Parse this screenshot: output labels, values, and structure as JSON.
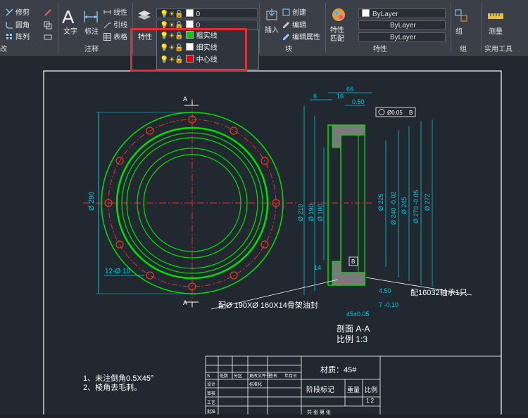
{
  "ribbon": {
    "modify": {
      "trim": "修剪",
      "fillet": "圆角",
      "array": "阵列",
      "panel_tail": "改"
    },
    "annotation": {
      "text": "文字",
      "dim": "标注",
      "linear": "线性",
      "leader": "引线",
      "table": "表格",
      "label": "注释"
    },
    "layers": {
      "props_btn": "特性",
      "current_layer": "0",
      "current_layer2": "0"
    },
    "insert": {
      "insert": "插入",
      "create": "创建",
      "edit": "编辑",
      "edit_attr": "编辑属性",
      "label": "块"
    },
    "properties": {
      "match": "特性\n匹配",
      "match1": "特性",
      "match2": "匹配",
      "color": "ByLayer",
      "linetype": "ByLayer",
      "lineweight": "ByLayer",
      "label": "特性"
    },
    "groups": {
      "group": "组",
      "label": "组"
    },
    "utilities": {
      "measure": "测量",
      "label": "实用工具"
    }
  },
  "layer_dropdown": {
    "items": [
      {
        "name": "粗实线",
        "color": "#00d000"
      },
      {
        "name": "细实线",
        "color": "#ffffff"
      },
      {
        "name": "中心线",
        "color": "#e00000"
      }
    ]
  },
  "drawing": {
    "notes": [
      "1、未注倒角0.5X45°",
      "2、棱角去毛刺。"
    ],
    "section_title": "剖面 A-A",
    "scale_text": "比例 1:3",
    "seal_label": "配Ø 190XØ 160X14骨架油封",
    "bearing_label": "配16032轴承1只",
    "material": "材质：45#",
    "title_block": {
      "stage": "阶段标记",
      "weight": "重量",
      "ratio": "比例",
      "ratio_value": "1:2",
      "design": "设计",
      "std": "标准化",
      "review": "审核",
      "process": "工艺",
      "approve": "批准",
      "s_label": "S",
      "marks": "处数",
      "zone": "分区",
      "docno": "更改文件号",
      "sign": "签名",
      "date": "年月日",
      "sheet": "共  张  第  张"
    },
    "dims": {
      "d290": "Ø 290",
      "hole": "12-Ø 10",
      "d66": "66",
      "d6": "6",
      "d16": "16",
      "d050": "0.50",
      "tol": "Ø0.05",
      "b": "B",
      "d210": "Ø 210",
      "d190": "Ø 190",
      "d180": "Ø 180",
      "d225": "Ø 225",
      "d240": "Ø 240 -0.02",
      "d245": "Ø 245",
      "d270": "Ø 270 -0.05",
      "d272": "Ø 272",
      "d14": "14",
      "d450": "4.50",
      "d7": "7 -0.10",
      "d45": "45±0.05",
      "a": "A"
    }
  }
}
